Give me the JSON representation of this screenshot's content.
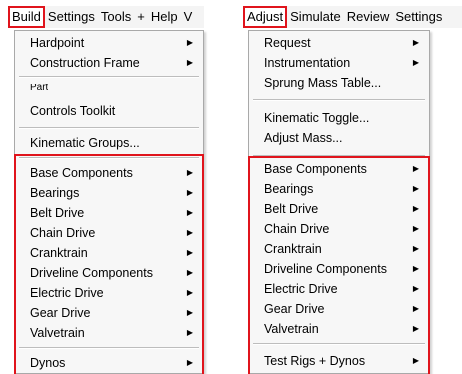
{
  "left": {
    "menubar": [
      "Build",
      "Settings",
      "Tools",
      "+",
      "Help",
      "V"
    ],
    "partial_item": "Part",
    "items": [
      {
        "label": "Hardpoint",
        "submenu": true
      },
      {
        "label": "Construction Frame",
        "submenu": true
      },
      {
        "label": "Controls Toolkit",
        "submenu": false
      },
      {
        "label": "Kinematic Groups...",
        "submenu": false
      },
      {
        "label": "Base Components",
        "submenu": true
      },
      {
        "label": "Bearings",
        "submenu": true
      },
      {
        "label": "Belt Drive",
        "submenu": true
      },
      {
        "label": "Chain Drive",
        "submenu": true
      },
      {
        "label": "Cranktrain",
        "submenu": true
      },
      {
        "label": "Driveline Components",
        "submenu": true
      },
      {
        "label": "Electric Drive",
        "submenu": true
      },
      {
        "label": "Gear Drive",
        "submenu": true
      },
      {
        "label": "Valvetrain",
        "submenu": true
      },
      {
        "label": "Dynos",
        "submenu": true
      }
    ]
  },
  "right": {
    "menubar": [
      "Adjust",
      "Simulate",
      "Review",
      "Settings"
    ],
    "items": [
      {
        "label": "Request",
        "submenu": true
      },
      {
        "label": "Instrumentation",
        "submenu": true
      },
      {
        "label": "Sprung Mass Table...",
        "submenu": false
      },
      {
        "label": "Kinematic Toggle...",
        "submenu": false
      },
      {
        "label": "Adjust Mass...",
        "submenu": false
      },
      {
        "label": "Base Components",
        "submenu": true
      },
      {
        "label": "Bearings",
        "submenu": true
      },
      {
        "label": "Belt Drive",
        "submenu": true
      },
      {
        "label": "Chain Drive",
        "submenu": true
      },
      {
        "label": "Cranktrain",
        "submenu": true
      },
      {
        "label": "Driveline Components",
        "submenu": true
      },
      {
        "label": "Electric Drive",
        "submenu": true
      },
      {
        "label": "Gear Drive",
        "submenu": true
      },
      {
        "label": "Valvetrain",
        "submenu": true
      },
      {
        "label": "Test Rigs + Dynos",
        "submenu": true
      }
    ]
  },
  "submenu_arrow_icon": "triangle-right-icon",
  "highlight_color": "#e0141c"
}
